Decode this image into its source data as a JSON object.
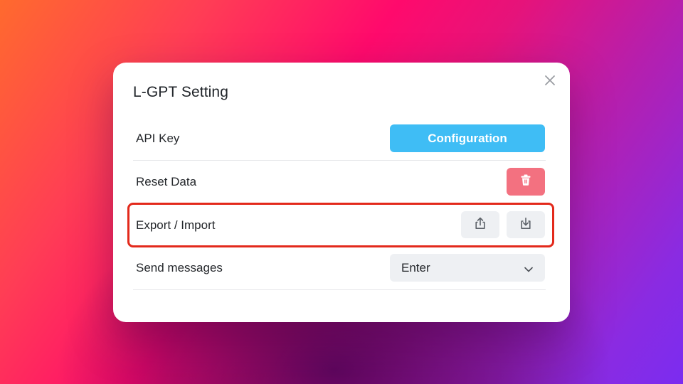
{
  "dialog": {
    "title": "L-GPT Setting",
    "close_icon": "close-icon"
  },
  "settings": {
    "api_key": {
      "label": "API Key",
      "button_label": "Configuration"
    },
    "reset_data": {
      "label": "Reset Data",
      "button_icon": "trash-icon"
    },
    "export_import": {
      "label": "Export / Import",
      "export_icon": "export-icon",
      "import_icon": "import-icon",
      "highlighted": true
    },
    "send_messages": {
      "label": "Send messages",
      "selected_value": "Enter",
      "dropdown_icon": "chevron-down-icon"
    }
  },
  "colors": {
    "primary_button": "#3fbdf5",
    "danger_button": "#f37180",
    "highlight_border": "#e3291b"
  }
}
